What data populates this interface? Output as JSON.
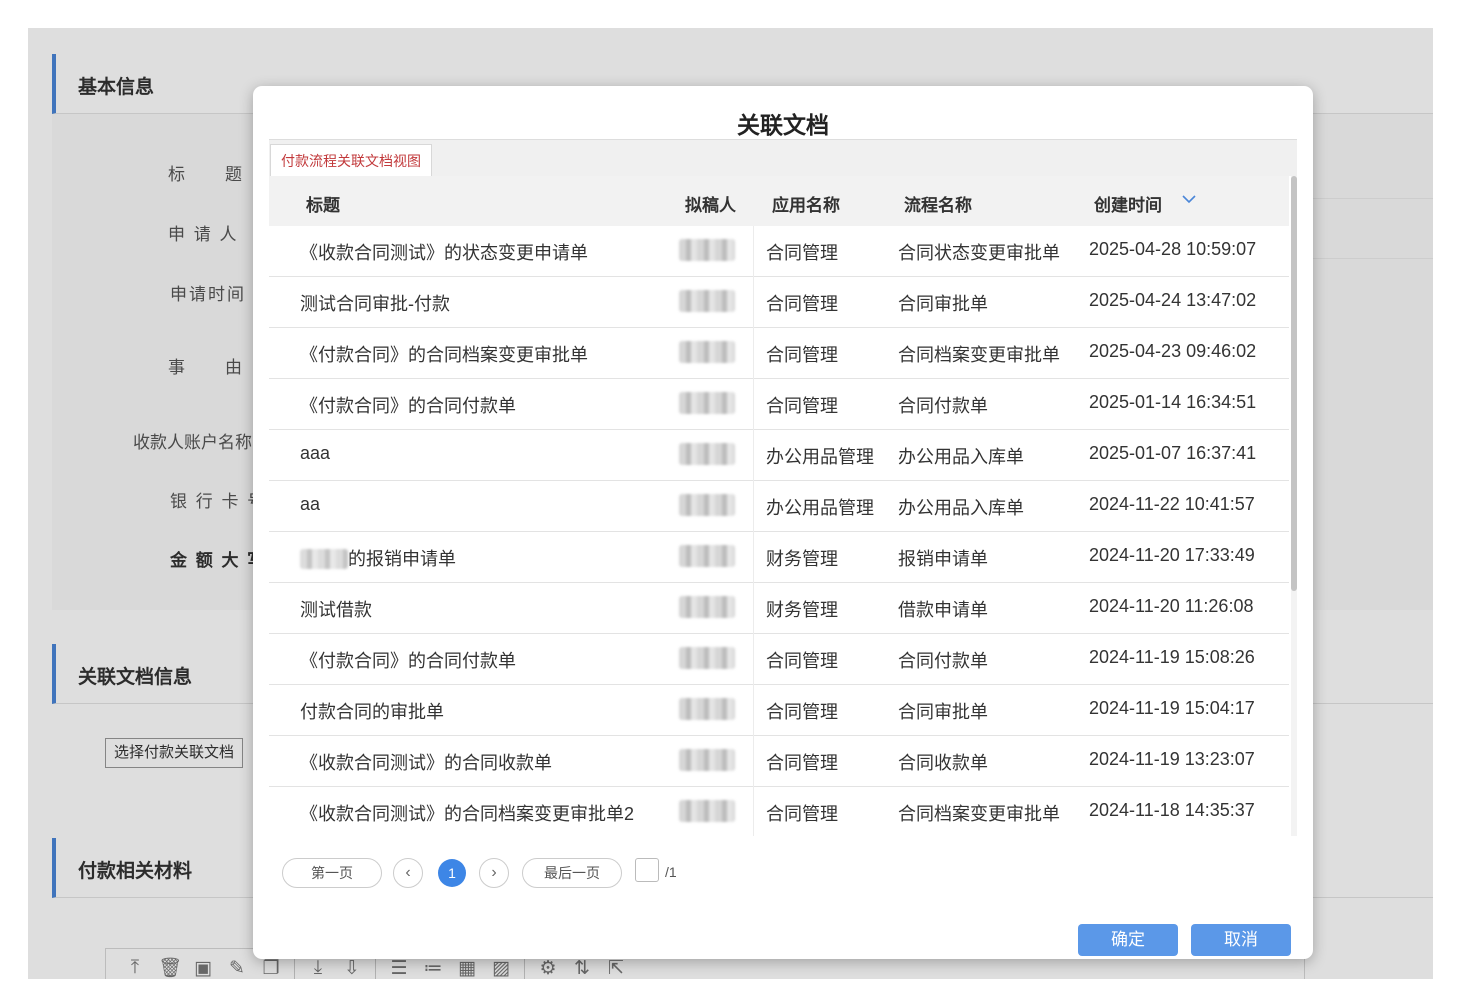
{
  "background_form": {
    "sections": {
      "basic_info": "基本信息",
      "related_docs": "关联文档信息",
      "payment_materials": "付款相关材料"
    },
    "fields": {
      "title": "标　　题",
      "applicant": "申 请 人",
      "apply_time": "申请时间",
      "reason": "事　　由",
      "payee_account": "收款人账户名称",
      "bank_card": "银 行 卡 号",
      "amount_caps": "金 额 大 写"
    },
    "choose_button": "选择付款关联文档",
    "toolbar_icons": [
      "upload-icon",
      "trash-icon",
      "scan-icon",
      "edit-icon",
      "copy-icon",
      "download-icon",
      "download-all-icon",
      "list-icon",
      "ordered-list-icon",
      "grid-icon",
      "image-icon",
      "gear-icon",
      "sort-icon",
      "export-icon"
    ]
  },
  "dialog": {
    "title": "关联文档",
    "tab": "付款流程关联文档视图",
    "columns": {
      "title": "标题",
      "drafter": "拟稿人",
      "app_name": "应用名称",
      "flow_name": "流程名称",
      "created_at": "创建时间"
    },
    "sort_icon": "chevron-down-icon",
    "rows": [
      {
        "title": "《收款合同测试》的状态变更申请单",
        "app": "合同管理",
        "flow": "合同状态变更审批单",
        "time": "2025-04-28 10:59:07"
      },
      {
        "title": "测试合同审批-付款",
        "app": "合同管理",
        "flow": "合同审批单",
        "time": "2025-04-24 13:47:02"
      },
      {
        "title": "《付款合同》的合同档案变更审批单",
        "app": "合同管理",
        "flow": "合同档案变更审批单",
        "time": "2025-04-23 09:46:02"
      },
      {
        "title": "《付款合同》的合同付款单",
        "app": "合同管理",
        "flow": "合同付款单",
        "time": "2025-01-14 16:34:51"
      },
      {
        "title": "aaa",
        "app": "办公用品管理",
        "flow": "办公用品入库单",
        "time": "2025-01-07 16:37:41"
      },
      {
        "title": "aa",
        "app": "办公用品管理",
        "flow": "办公用品入库单",
        "time": "2024-11-22 10:41:57"
      },
      {
        "title": "的报销申请单",
        "app": "财务管理",
        "flow": "报销申请单",
        "time": "2024-11-20 17:33:49"
      },
      {
        "title": "测试借款",
        "app": "财务管理",
        "flow": "借款申请单",
        "time": "2024-11-20 11:26:08"
      },
      {
        "title": "《付款合同》的合同付款单",
        "app": "合同管理",
        "flow": "合同付款单",
        "time": "2024-11-19 15:08:26"
      },
      {
        "title": "付款合同的审批单",
        "app": "合同管理",
        "flow": "合同审批单",
        "time": "2024-11-19 15:04:17"
      },
      {
        "title": "《收款合同测试》的合同收款单",
        "app": "合同管理",
        "flow": "合同收款单",
        "time": "2024-11-19 13:23:07"
      },
      {
        "title": "《收款合同测试》的合同档案变更审批单2",
        "app": "合同管理",
        "flow": "合同档案变更审批单",
        "time": "2024-11-18 14:35:37"
      }
    ],
    "pager": {
      "first": "第一页",
      "prev": "‹",
      "current": "1",
      "next": "›",
      "last": "最后一页",
      "total": "/1"
    },
    "buttons": {
      "confirm": "确定",
      "cancel": "取消"
    }
  }
}
